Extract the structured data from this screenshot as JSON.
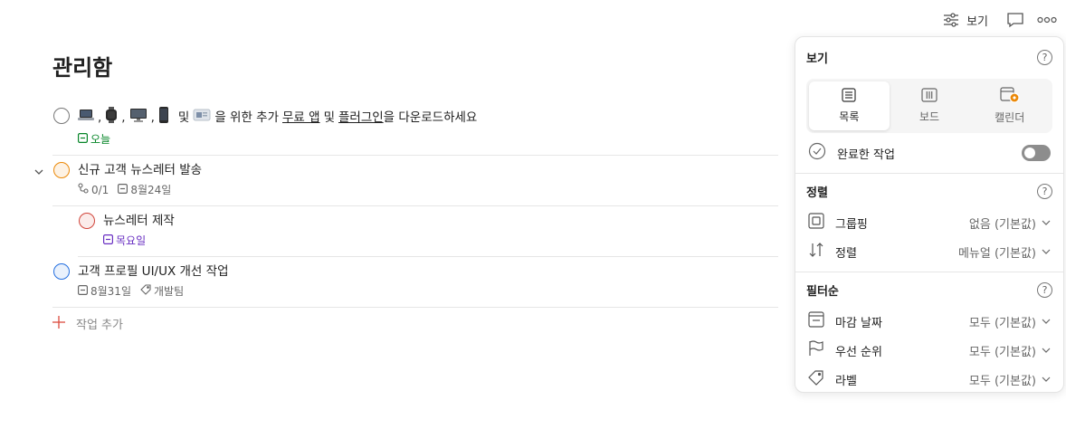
{
  "topbar": {
    "view_label": "보기",
    "view_icon": "sliders-icon",
    "comment_icon": "comment-icon",
    "more_icon": "more-icon"
  },
  "page": {
    "title": "관리함"
  },
  "tasks": [
    {
      "title_parts": {
        "sep1": ",",
        "sep2": ",",
        "sep3": ",",
        "text_a": "및",
        "text_b": "을 위한 추가",
        "link1": "무료 앱",
        "text_c": "및",
        "link2": "플러그인",
        "text_d": "을 다운로드하세요"
      },
      "date": "오늘"
    },
    {
      "title": "신규 고객 뉴스레터 발송",
      "subtasks": "0/1",
      "date": "8월24일"
    },
    {
      "title": "뉴스레터 제작",
      "date": "목요일"
    },
    {
      "title": "고객 프로필 UI/UX 개선 작업",
      "date": "8월31일",
      "label": "개발팀"
    }
  ],
  "add_task": {
    "label": "작업 추가"
  },
  "panel": {
    "view_header": "보기",
    "help": "?",
    "views": [
      {
        "label": "목록",
        "icon": "list-icon",
        "active": true
      },
      {
        "label": "보드",
        "icon": "board-icon",
        "active": false
      },
      {
        "label": "캘린더",
        "icon": "calendar-icon",
        "active": false
      }
    ],
    "completed": {
      "label": "완료한 작업",
      "enabled": false
    },
    "sort_header": "정렬",
    "grouping": {
      "label": "그룹핑",
      "value": "없음 (기본값)"
    },
    "sorting": {
      "label": "정렬",
      "value": "메뉴얼 (기본값)"
    },
    "filter_header": "필터순",
    "due_date": {
      "label": "마감 날짜",
      "value": "모두 (기본값)"
    },
    "priority": {
      "label": "우선 순위",
      "value": "모두 (기본값)"
    },
    "labels": {
      "label": "라벨",
      "value": "모두 (기본값)"
    }
  },
  "colors": {
    "accent": "#dc4c3e",
    "orange": "#eb8909",
    "red": "#d1453b",
    "blue": "#246fe0",
    "green": "#058527",
    "purple": "#692fc2"
  }
}
